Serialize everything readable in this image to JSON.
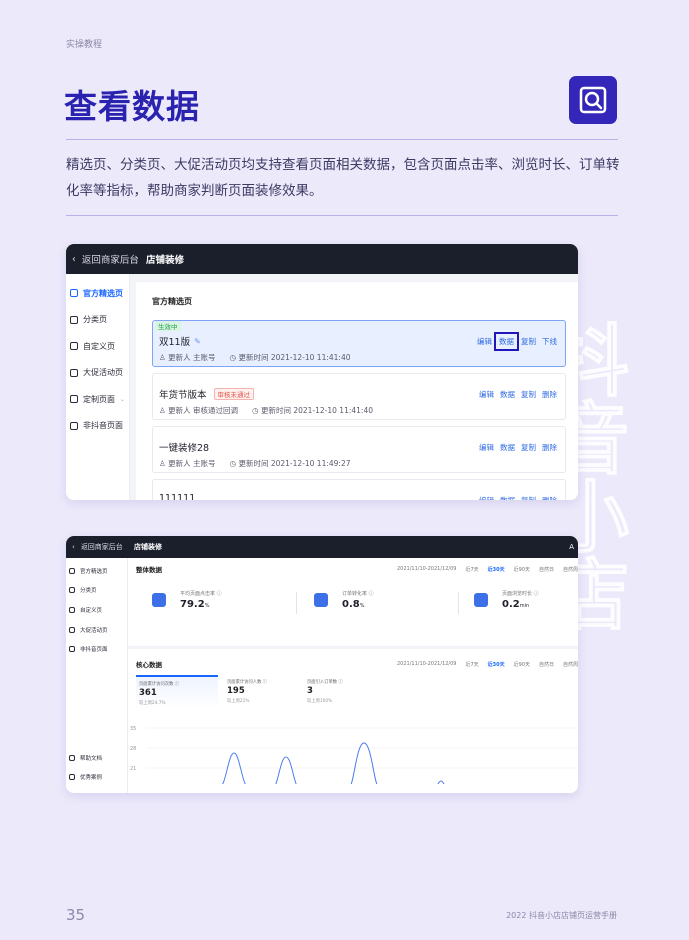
{
  "section_tag": "实操教程",
  "page_title": "查看数据",
  "intro": "精选页、分类页、大促活动页均支持查看页面相关数据，包含页面点击率、浏览时长、订单转化率等指标，帮助商家判断页面装修效果。",
  "watermark_text": "抖音小店",
  "colors": {
    "background": "#ece9fb",
    "title": "#2a23b0",
    "accent_blue": "#1966ff",
    "topbar": "#1b1e2b"
  },
  "screenshot1": {
    "back_label": "返回商家后台",
    "store_title": "店铺装修",
    "nav": [
      "官方精选页",
      "分类页",
      "自定义页",
      "大促活动页",
      "定制页面",
      "非抖音页面"
    ],
    "panel_title": "官方精选页",
    "cards": [
      {
        "status": "生效中",
        "name": "双11版",
        "badge": "",
        "updater": "更新人 主账号",
        "time": "更新时间 2021-12-10 11:41:40",
        "actions": [
          "编辑",
          "数据",
          "复制",
          "下线"
        ]
      },
      {
        "status": "",
        "name": "年货节版本",
        "badge": "审核未通过",
        "updater": "更新人 审核通过回调",
        "time": "更新时间 2021-12-10 11:41:40",
        "actions": [
          "编辑",
          "数据",
          "复制",
          "删除"
        ]
      },
      {
        "status": "",
        "name": "一键装修28",
        "badge": "",
        "updater": "更新人 主账号",
        "time": "更新时间 2021-12-10 11:49:27",
        "actions": [
          "编辑",
          "数据",
          "复制",
          "删除"
        ]
      },
      {
        "status": "",
        "name": "111111",
        "badge": "",
        "updater": "",
        "time": "",
        "actions": [
          "编辑",
          "数据",
          "复制",
          "删除"
        ]
      }
    ]
  },
  "screenshot2": {
    "back_label": "返回商家后台",
    "store_title": "店铺装修",
    "avatar": "A",
    "nav": [
      "官方精选页",
      "分类页",
      "自定义页",
      "大促活动页",
      "非抖音页面"
    ],
    "nav_bottom": [
      "帮助文档",
      "优秀案例"
    ],
    "overall_title": "整体数据",
    "date_range": "2021/11/10-2021/12/09",
    "range_options": [
      "近7天",
      "近30天",
      "近90天",
      "自然日",
      "自然周"
    ],
    "selected_range": "近30天",
    "metrics": [
      {
        "label": "平均页面点击率 ⓘ",
        "value": "79.2",
        "unit": "%"
      },
      {
        "label": "订单转化率 ⓘ",
        "value": "0.8",
        "unit": "%"
      },
      {
        "label": "页面浏览时长 ⓘ",
        "value": "0.2",
        "unit": "min"
      }
    ],
    "core_title": "核心数据",
    "core_tabs": [
      {
        "label": "页面累计访问次数 ⓘ",
        "value": "361",
        "sub": "较上周24.7%"
      },
      {
        "label": "页面累计访问人数 ⓘ",
        "value": "195",
        "sub": "较上周21%"
      },
      {
        "label": "页面引入订单数 ⓘ",
        "value": "3",
        "sub": "较上周100%"
      }
    ],
    "chart_ticks": [
      "35",
      "28",
      "21"
    ]
  },
  "footer": {
    "page_number": "35",
    "text": "2022  抖音小店店铺页运营手册"
  }
}
